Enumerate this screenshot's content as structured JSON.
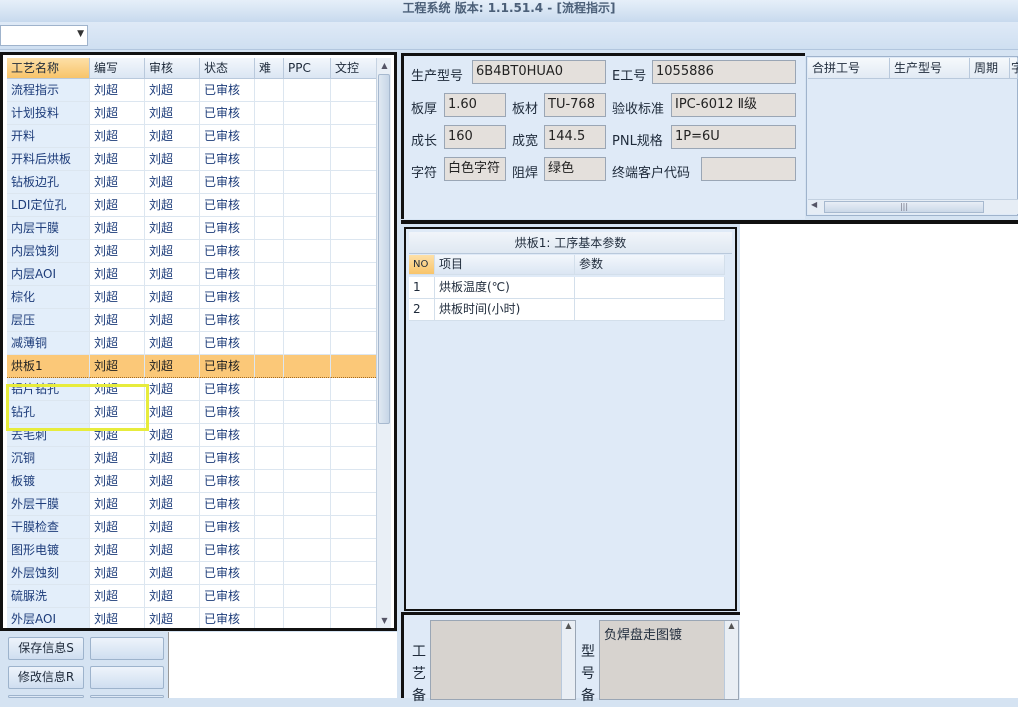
{
  "window": {
    "title": "工程系统 版本: 1.1.51.4 - [流程指示]"
  },
  "toolbar": {
    "combo_value": ""
  },
  "process_grid": {
    "columns": [
      "工艺名称",
      "编写",
      "审核",
      "状态",
      "难",
      "PPC",
      "文控"
    ],
    "rows": [
      [
        "流程指示",
        "刘超",
        "刘超",
        "已审核"
      ],
      [
        "计划投料",
        "刘超",
        "刘超",
        "已审核"
      ],
      [
        "开料",
        "刘超",
        "刘超",
        "已审核"
      ],
      [
        "开料后烘板",
        "刘超",
        "刘超",
        "已审核"
      ],
      [
        "钻板边孔",
        "刘超",
        "刘超",
        "已审核"
      ],
      [
        "LDI定位孔",
        "刘超",
        "刘超",
        "已审核"
      ],
      [
        "内层干膜",
        "刘超",
        "刘超",
        "已审核"
      ],
      [
        "内层蚀刻",
        "刘超",
        "刘超",
        "已审核"
      ],
      [
        "内层AOI",
        "刘超",
        "刘超",
        "已审核"
      ],
      [
        "棕化",
        "刘超",
        "刘超",
        "已审核"
      ],
      [
        "层压",
        "刘超",
        "刘超",
        "已审核"
      ],
      [
        "减薄铜",
        "刘超",
        "刘超",
        "已审核"
      ],
      [
        "烘板1",
        "刘超",
        "刘超",
        "已审核"
      ],
      [
        "铝片钻孔",
        "刘超",
        "刘超",
        "已审核"
      ],
      [
        "钻孔",
        "刘超",
        "刘超",
        "已审核"
      ],
      [
        "去毛刺",
        "刘超",
        "刘超",
        "已审核"
      ],
      [
        "沉铜",
        "刘超",
        "刘超",
        "已审核"
      ],
      [
        "板镀",
        "刘超",
        "刘超",
        "已审核"
      ],
      [
        "外层干膜",
        "刘超",
        "刘超",
        "已审核"
      ],
      [
        "干膜检查",
        "刘超",
        "刘超",
        "已审核"
      ],
      [
        "图形电镀",
        "刘超",
        "刘超",
        "已审核"
      ],
      [
        "外层蚀刻",
        "刘超",
        "刘超",
        "已审核"
      ],
      [
        "硫脲洗",
        "刘超",
        "刘超",
        "已审核"
      ],
      [
        "外层AOI",
        "刘超",
        "刘超",
        "已审核"
      ]
    ],
    "selected_row": "烘板1"
  },
  "buttons": {
    "save": "保存信息S",
    "modify": "修改信息R"
  },
  "product_form": {
    "model_label": "生产型号",
    "model_value": "6B4BT0HUA0",
    "eno_label": "E工号",
    "eno_value": "1055886",
    "thickness_label": "板厚",
    "thickness_value": "1.60",
    "material_label": "板材",
    "material_value": "TU-768",
    "standard_label": "验收标准",
    "standard_value": "IPC-6012 Ⅱ级",
    "length_label": "成长",
    "length_value": "160",
    "width_label": "成宽",
    "width_value": "144.5",
    "pnl_label": "PNL规格",
    "pnl_value": "1P=6U",
    "char_label": "字符",
    "char_value": "白色字符",
    "mask_label": "阻焊",
    "mask_value": "绿色",
    "customer_label": "终端客户代码",
    "customer_value": ""
  },
  "merge_list": {
    "columns": [
      "合拼工号",
      "生产型号",
      "周期",
      "字"
    ]
  },
  "params_panel": {
    "title": "烘板1: 工序基本参数",
    "columns": [
      "NO",
      "项目",
      "参数"
    ],
    "rows": [
      {
        "no": "1",
        "item": "烘板温度(℃)",
        "value": ""
      },
      {
        "no": "2",
        "item": "烘板时间(小时)",
        "value": ""
      }
    ]
  },
  "memo": {
    "process_label": "工艺备",
    "model_label": "型号备",
    "model_memo": "负焊盘走图镀"
  }
}
